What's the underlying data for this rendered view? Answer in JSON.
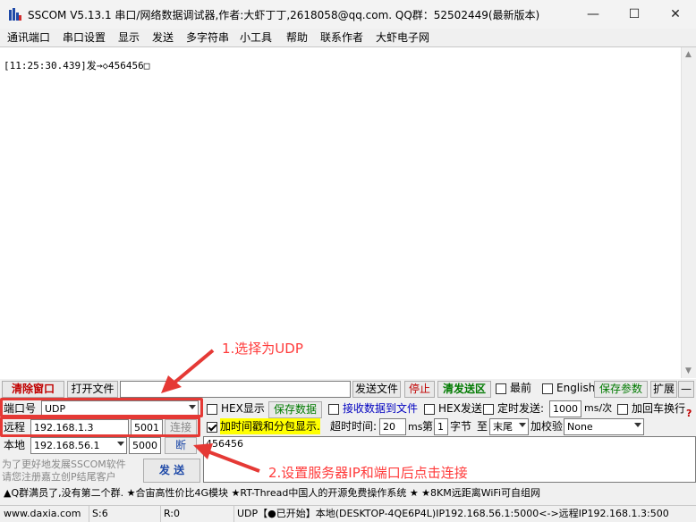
{
  "window": {
    "title": "SSCOM V5.13.1 串口/网络数据调试器,作者:大虾丁丁,2618058@qq.com. QQ群：52502449(最新版本)",
    "minimize": "—",
    "maximize": "☐",
    "close": "✕"
  },
  "menu": [
    "通讯端口",
    "串口设置",
    "显示",
    "发送",
    "多字符串",
    "小工具",
    "帮助",
    "联系作者",
    "大虾电子网"
  ],
  "receive": {
    "line": "[11:25:30.439]发→◇456456□"
  },
  "toolbar": {
    "clear_window": "清除窗口",
    "open_file": "打开文件",
    "send_file": "发送文件",
    "stop": "停止",
    "clear_send": "清发送区",
    "topmost": "最前",
    "english": "English",
    "save_params": "保存参数",
    "expand": "扩展",
    "collapse": "—"
  },
  "connection": {
    "port_label": "端口号",
    "port_value": "UDP",
    "remote_label": "远程",
    "remote_ip": "192.168.1.3",
    "remote_port": "5001",
    "connect": "连接",
    "local_label": "本地",
    "local_ip": "192.168.56.1",
    "local_port": "5000",
    "disconnect": "断"
  },
  "options": {
    "hex_display": "HEX显示",
    "save_data": "保存数据",
    "recv_to_file": "接收数据到文件",
    "hex_send": "HEX发送",
    "timed_send": "定时发送:",
    "interval": "1000",
    "interval_unit": "ms/次",
    "add_newline": "加回车换行",
    "timestamp": "加时间戳和分包显示.",
    "timeout_label": "超时时间:",
    "timeout": "20",
    "timeout_unit": "ms",
    "byte_prefix": "第",
    "byte_from": "1",
    "byte_unit": "字节",
    "byte_to_label": "至",
    "byte_to": "末尾",
    "checksum_label": "加校验",
    "checksum": "None",
    "help": "?"
  },
  "send": {
    "content": "456456",
    "button": "发 送",
    "promo_line1": "为了更好地发展SSCOM软件",
    "promo_line2": "请您注册嘉立创P结尾客户"
  },
  "annotations": {
    "step1": "1.选择为UDP",
    "step2": "2.设置服务器IP和端口后点击连接"
  },
  "ticker": "▲Q群满员了,没有第二个群. ★合宙高性价比4G模块 ★RT-Thread中国人的开源免费操作系统 ★ ★8KM远距离WiFi可自组网",
  "status": {
    "url": "www.daxia.com",
    "sent": "S:6",
    "received": "R:0",
    "info": "UDP【●已开始】本地(DESKTOP-4QE6P4L)IP192.168.56.1:5000<->远程IP192.168.1.3:500"
  },
  "colors": {
    "annotation": "#e53935",
    "clear_red": "#c00000",
    "save_green": "#007a00",
    "timestamp_bg": "#ffff00"
  }
}
